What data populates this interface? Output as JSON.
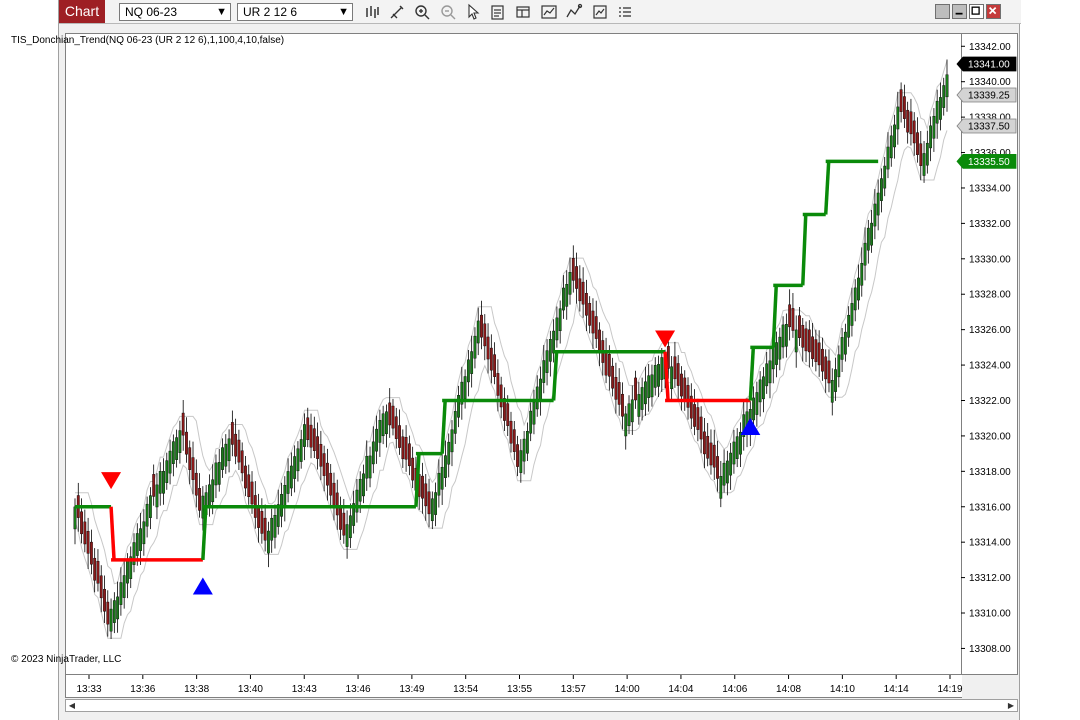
{
  "toolbar": {
    "chart_tab": "Chart",
    "instrument": "NQ 06-23",
    "bar_type": "UR 2 12 6",
    "icons": [
      "bar-style-icon",
      "drawing-tools-icon",
      "zoom-in-icon",
      "zoom-out-icon",
      "pointer-icon",
      "data-box-icon",
      "properties-icon",
      "indicators-icon",
      "strategies-icon",
      "templates-icon",
      "more-icon"
    ],
    "window_buttons": [
      "tile-icon",
      "minimize-icon",
      "maximize-icon",
      "close-icon"
    ]
  },
  "indicator_label": "TIS_Donchian_Trend(NQ 06-23 (UR 2 12 6),1,100,4,10,false)",
  "copyright": "© 2023 NinjaTrader, LLC",
  "colors": {
    "up_bar": "#1a7a1a",
    "down_bar": "#8b1a1a",
    "trend_up": "#0a8a0a",
    "trend_down": "#ff0000",
    "channel": "#c8c8c8",
    "buy_signal": "#0000ff",
    "sell_signal": "#ff0000",
    "last_price_bg": "#000000",
    "chart_tab_bg": "#9e1f24"
  },
  "chart_data": {
    "type": "candlestick",
    "ylim": [
      13306.5,
      13342.75
    ],
    "y_ticks": [
      "13342.00",
      "13340.00",
      "13338.00",
      "13336.00",
      "13334.00",
      "13332.00",
      "13330.00",
      "13328.00",
      "13326.00",
      "13324.00",
      "13322.00",
      "13320.00",
      "13318.00",
      "13316.00",
      "13314.00",
      "13312.00",
      "13310.00",
      "13308.00"
    ],
    "x_ticks": [
      "13:33",
      "13:36",
      "13:38",
      "13:40",
      "13:43",
      "13:46",
      "13:49",
      "13:54",
      "13:55",
      "13:57",
      "14:00",
      "14:04",
      "14:06",
      "14:08",
      "14:10",
      "14:14",
      "14:19"
    ],
    "price_markers": [
      {
        "label": "13341.00",
        "style": "last"
      },
      {
        "label": "13339.25",
        "style": "gray"
      },
      {
        "label": "13337.50",
        "style": "gray"
      },
      {
        "label": "13335.50",
        "style": "green"
      }
    ],
    "price_markers_values": [
      13341.0,
      13339.25,
      13337.5,
      13335.5
    ],
    "close_path": [
      [
        0,
        13316.0
      ],
      [
        10,
        13309.5
      ],
      [
        19,
        13314.5
      ],
      [
        32,
        13320.5
      ],
      [
        38,
        13316.0
      ],
      [
        47,
        13320.0
      ],
      [
        58,
        13314.0
      ],
      [
        70,
        13320.5
      ],
      [
        82,
        13314.5
      ],
      [
        94,
        13321.5
      ],
      [
        108,
        13315.5
      ],
      [
        123,
        13326.5
      ],
      [
        135,
        13318.5
      ],
      [
        151,
        13329.5
      ],
      [
        167,
        13321.0
      ],
      [
        180,
        13324.5
      ],
      [
        196,
        13317.5
      ],
      [
        217,
        13326.5
      ],
      [
        231,
        13323.0
      ],
      [
        251,
        13338.5
      ],
      [
        258,
        13335.5
      ],
      [
        266,
        13340.5
      ]
    ],
    "bar_count": 267,
    "trend_line": [
      {
        "from": 0,
        "to": 11,
        "value": 13316.0,
        "dir": "up"
      },
      {
        "from": 11,
        "to": 39,
        "value": 13313.0,
        "dir": "down"
      },
      {
        "from": 39,
        "to": 104,
        "value": 13316.0,
        "dir": "up"
      },
      {
        "from": 104,
        "to": 112,
        "value": 13319.0,
        "dir": "up"
      },
      {
        "from": 112,
        "to": 146,
        "value": 13322.0,
        "dir": "up"
      },
      {
        "from": 146,
        "to": 180,
        "value": 13324.75,
        "dir": "up"
      },
      {
        "from": 180,
        "to": 206,
        "value": 13322.0,
        "dir": "down"
      },
      {
        "from": 206,
        "to": 213,
        "value": 13325.0,
        "dir": "up"
      },
      {
        "from": 213,
        "to": 222,
        "value": 13328.5,
        "dir": "up"
      },
      {
        "from": 222,
        "to": 229,
        "value": 13332.5,
        "dir": "up"
      },
      {
        "from": 229,
        "to": 245,
        "value": 13335.5,
        "dir": "up"
      }
    ],
    "signals": [
      {
        "type": "sell",
        "bar": 11,
        "value": 13317.5
      },
      {
        "type": "buy",
        "bar": 39,
        "value": 13311.5
      },
      {
        "type": "sell",
        "bar": 180,
        "value": 13325.5
      },
      {
        "type": "buy",
        "bar": 206,
        "value": 13320.5
      }
    ]
  }
}
